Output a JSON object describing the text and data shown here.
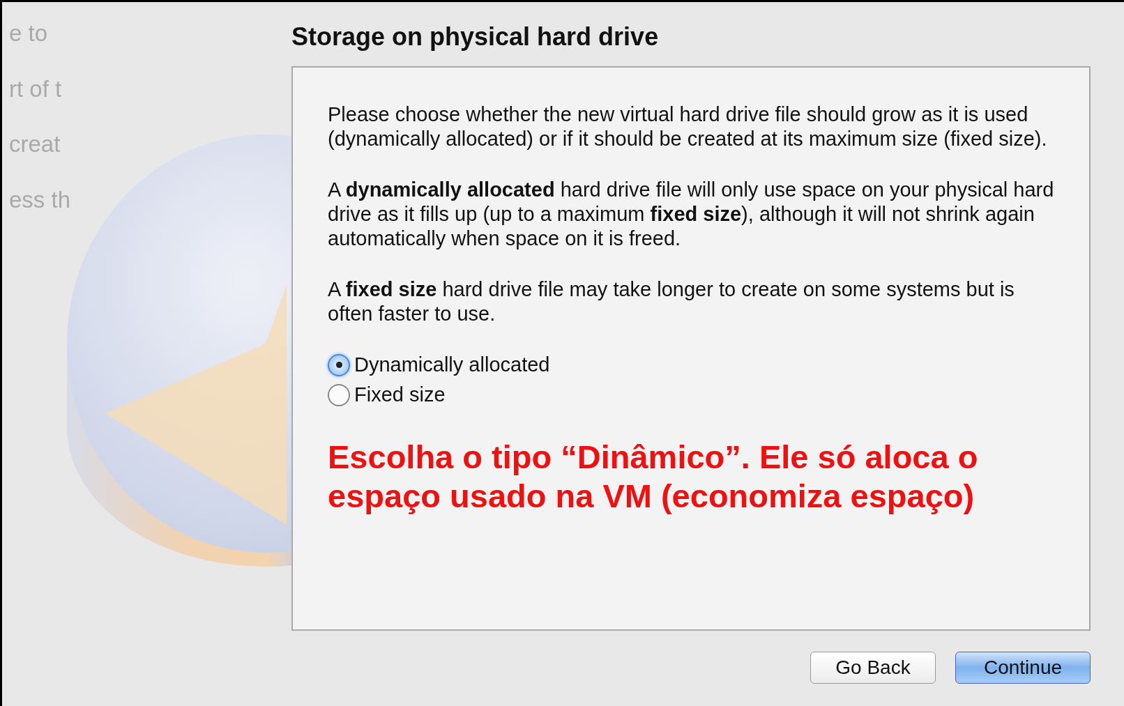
{
  "background_fragments": [
    "e to",
    "rt of t",
    "creat",
    "ess th"
  ],
  "dialog": {
    "title": "Storage on physical hard drive",
    "paragraphs": [
      "Please choose whether the new virtual hard drive file should grow as it is used (dynamically allocated) or if it should be created at its maximum size (fixed size).",
      "A **dynamically allocated** hard drive file will only use space on your physical hard drive as it fills up (up to a maximum **fixed size**), although it will not shrink again automatically when space on it is freed.",
      "A **fixed size** hard drive file may take longer to create on some systems but is often faster to use."
    ],
    "options": [
      {
        "label": "Dynamically allocated",
        "selected": true
      },
      {
        "label": "Fixed size",
        "selected": false
      }
    ],
    "annotation": "Escolha o tipo “Dinâmico”. Ele só aloca o espaço usado na VM (economiza espaço)"
  },
  "buttons": [
    {
      "label": "Go Back",
      "default": false
    },
    {
      "label": "Continue",
      "default": true
    }
  ]
}
